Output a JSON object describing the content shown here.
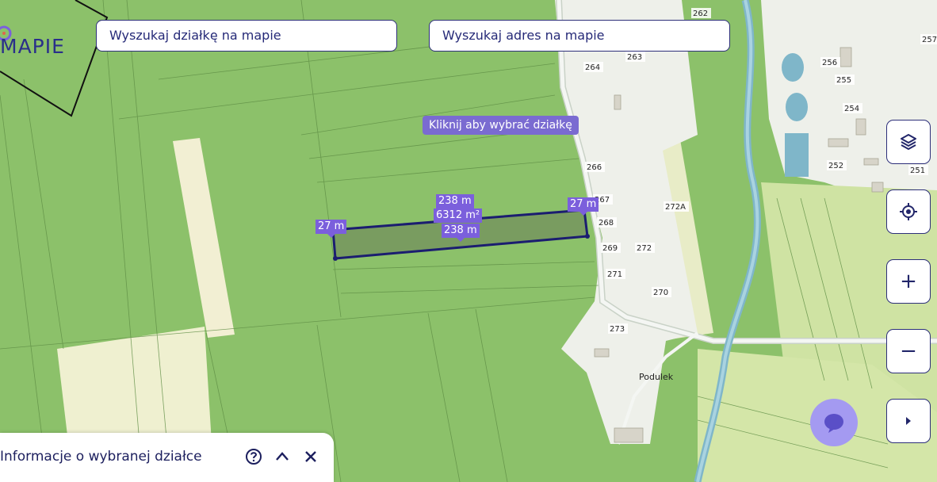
{
  "search": {
    "parcel_placeholder": "Wyszukaj działkę na mapie",
    "address_placeholder": "Wyszukaj adres na mapie"
  },
  "logo": {
    "text": "MAPIE"
  },
  "map": {
    "tooltip": "Kliknij aby wybrać działkę",
    "house_numbers": [
      "262",
      "263",
      "264",
      "257",
      "256",
      "255",
      "254",
      "252",
      "251",
      "266",
      "267",
      "268",
      "269",
      "271",
      "272",
      "272A",
      "270",
      "273"
    ],
    "place_name": "Podulek"
  },
  "measurement": {
    "side_top": "238 m",
    "area": "6312 m²",
    "side_bottom": "238 m",
    "side_left": "27 m",
    "side_right": "27 m"
  },
  "controls": {
    "layers": "layers-icon",
    "locate": "locate-icon",
    "zoom_in": "+",
    "zoom_out": "−",
    "expand": "play-icon"
  },
  "panel": {
    "title": "Informacje o wybranej działce"
  },
  "colors": {
    "brand": "#2a2f8a",
    "accent": "#7b5fdc",
    "forest": "#8cc16a",
    "field": "#f3f0d6",
    "river": "#7fb6c9"
  }
}
